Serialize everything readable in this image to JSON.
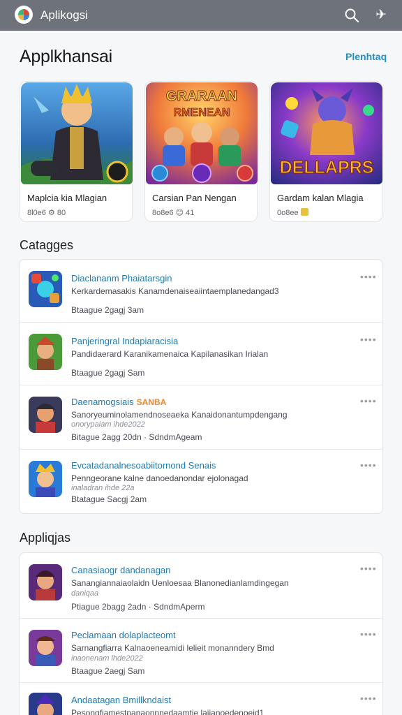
{
  "topbar": {
    "app_name": "Aplikogsi",
    "icons": [
      "app-logo-icon",
      "search-icon",
      "airplane-icon"
    ]
  },
  "header": {
    "title": "Applkhansai",
    "link": "Plenhtaq"
  },
  "featured": [
    {
      "title": "Maplcia kia Mlagian",
      "meta": "8l0e6 ⚙ 80",
      "art_text": ""
    },
    {
      "title": "Carsian Pan Nengan",
      "meta": "8o8e6 😊 41",
      "art_text": "GRARAAN RMENEAN"
    },
    {
      "title": "Gardam kalan Mlagia",
      "meta": "0o8ee",
      "art_text": "DELLAPRS"
    }
  ],
  "sections": {
    "categories": "Catagges",
    "applications": "Appliqjas"
  },
  "categories_list": [
    {
      "title": "Diaclananm Phaiatarsgin",
      "tag": "",
      "desc": "Kerkardemasakis Kanamdenaiseaiintaemplanedangad3",
      "desc2": "",
      "meta": "Btaague 2gagj 3am"
    },
    {
      "title": "Panjeringral Indapiaracisia",
      "tag": "",
      "desc": "Pandidaerard Karanikamenaica Kapilanasikan Irialan",
      "desc2": "",
      "meta": "Btaague 2gagj Sam"
    },
    {
      "title": "Daenamogsiais",
      "tag": "SANBA",
      "desc": "Sanoryeuminolamendnoseaeka Kanaidonantumpdengang",
      "desc2": "onorypaiam ihde2022",
      "meta": "Bitague 2agg 20dn · SdndmAgeam"
    },
    {
      "title": "Evcatadanalnesoabiitornond Senais",
      "tag": "",
      "desc": "Penngeorane kalne danoedanondar ejolonagad",
      "desc2": "inaladran ihde 22a",
      "meta": "Btatague Sacgj 2am"
    }
  ],
  "applications_list": [
    {
      "title": "Canasiaogr dandanagan",
      "desc": "Sanangiannaiaolaidn Uenloesaa Blanonedianlamdingegan",
      "desc2": "daniqaa",
      "meta": "Ptiague 2bagg 2adn · SdndmAperm"
    },
    {
      "title": "Peclamaan dolaplacteomt",
      "desc": "Sarnangfiarra Kalnaoeneamidi lelieit monanndery Bmd",
      "desc2": "inaonenam ihde2022",
      "meta": "Btaague 2aegj Sam"
    },
    {
      "title": "Andaatagan Bmillkndaist",
      "desc": "Pesongfiamestpanaonnnedaamtie laiianoedenoeid1",
      "desc2": "",
      "meta": ""
    }
  ],
  "more_label": "••••",
  "colors": {
    "topbar": "#6e727a",
    "link": "#1f8fc8",
    "row_title": "#1f7ab3",
    "tag": "#f2862a"
  }
}
